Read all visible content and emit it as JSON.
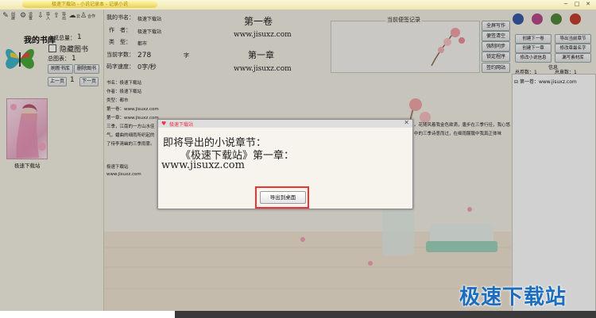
{
  "window": {
    "title": "极速下载站 - 小说记录本 - 记录小说",
    "controls": [
      "─",
      "□",
      "✕"
    ]
  },
  "toolbar": {
    "items": [
      {
        "icon": "pencil-icon",
        "label": "创建"
      },
      {
        "icon": "gear-icon",
        "label": "设置"
      },
      {
        "icon": "import-icon",
        "label": "导入"
      },
      {
        "icon": "export-icon",
        "label": "导出"
      },
      {
        "icon": "cloud-icon",
        "label": "云"
      },
      {
        "icon": "person-icon",
        "label": "合作"
      }
    ]
  },
  "library": {
    "title": "我的书库",
    "total_label": "小说总量：",
    "total_value": "1",
    "hide_label": "隐藏图书",
    "total_books_label": "总图表：",
    "total_books_value": "1",
    "refresh_label": "刷新书库",
    "delete_label": "删除图书",
    "prev_label": "上一页",
    "page_value": "1",
    "next_label": "下一页",
    "book_caption": "极速下载站"
  },
  "book": {
    "name_label": "我的书名：",
    "name_value": "极速下载站",
    "author_label": "作　者：",
    "author_value": "极速下载站",
    "type_label": "类　型：",
    "type_value": "都市",
    "words_label": "当前字数：",
    "words_value": "278",
    "words_unit": "字",
    "speed_label": "码字速度：",
    "speed_value": "0字/秒",
    "volume_title": "第一卷",
    "volume_url": "www.jisuxz.com",
    "chapter_title": "第一章",
    "chapter_url": "www.jisuxz.com"
  },
  "content": {
    "lines": [
      "书名：极速下载站",
      "作者：极速下载站",
      "类型：都市",
      "第一卷：www.jisuxz.com",
      "第一章：www.jisuxz.com",
      "三季，江南的一方山水佳"
    ],
    "tail_lines": [
      "气，蟠曲的细雨所织起的",
      "了待李清幽的三季雨雾。"
    ],
    "footer_name": "极速下载站",
    "footer_url": "www.jisuxz.com",
    "right_fragment_1": "。花随风着我金色欲滴，唐步在三季行径，我心悠",
    "right_fragment_2": "中的三季诗意而过，在细雨朦胧中我真正体味"
  },
  "notes": {
    "title": "当前便签记录",
    "buttons": [
      "全屏写作",
      "便签清空",
      "强制同步",
      "锁定程序",
      "签约网站"
    ]
  },
  "actions": {
    "buttons": [
      "创建下一卷",
      "导出当前章节",
      "创建下一章",
      "修改章最名字",
      "修改小说信息",
      "漏写素材库"
    ]
  },
  "stats": {
    "info_label": "信息",
    "total_volumes": "总卷数：1",
    "total_chapters": "总章数：1"
  },
  "tree": {
    "root": "第一卷：www.jisuxz.com"
  },
  "dialog": {
    "title": "极速下载站",
    "line1": "即将导出的小说章节：",
    "line2": "《极速下载站》第一章：",
    "line3": "www.jisuxz.com",
    "button": "导出到桌面"
  },
  "watermark": "极速下载站"
}
